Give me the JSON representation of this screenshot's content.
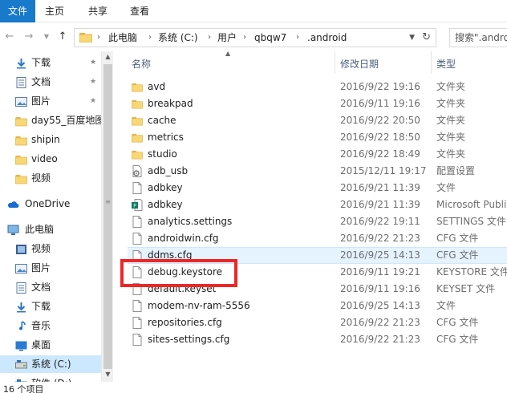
{
  "ribbon": {
    "tabs": [
      "文件",
      "主页",
      "共享",
      "查看"
    ]
  },
  "address": {
    "crumbs": [
      "此电脑",
      "系统 (C:)",
      "用户",
      "qbqw7",
      ".android"
    ],
    "search_placeholder": "搜索\".andro"
  },
  "nav": {
    "items": [
      {
        "label": "下载",
        "icon": "download-arrow-icon",
        "pinned": true
      },
      {
        "label": "文档",
        "icon": "document-icon",
        "pinned": true
      },
      {
        "label": "图片",
        "icon": "picture-icon",
        "pinned": true
      },
      {
        "label": "day55_百度地图",
        "icon": "folder-icon",
        "pinned": false
      },
      {
        "label": "shipin",
        "icon": "folder-icon",
        "pinned": false
      },
      {
        "label": "video",
        "icon": "folder-icon",
        "pinned": false
      },
      {
        "label": "视频",
        "icon": "folder-icon",
        "pinned": false
      },
      {
        "label": "OneDrive",
        "icon": "cloud-icon",
        "pinned": false
      },
      {
        "label": "此电脑",
        "icon": "computer-icon",
        "pinned": false
      },
      {
        "label": "视频",
        "icon": "video-icon",
        "pinned": false
      },
      {
        "label": "图片",
        "icon": "picture-icon",
        "pinned": false
      },
      {
        "label": "文档",
        "icon": "document-icon",
        "pinned": false
      },
      {
        "label": "下载",
        "icon": "download-arrow-icon",
        "pinned": false
      },
      {
        "label": "音乐",
        "icon": "music-note-icon",
        "pinned": false
      },
      {
        "label": "桌面",
        "icon": "desktop-icon",
        "pinned": false
      },
      {
        "label": "系统 (C:)",
        "icon": "drive-icon",
        "pinned": false
      },
      {
        "label": "软件 (D:)",
        "icon": "drive-icon",
        "pinned": false
      }
    ]
  },
  "columns": {
    "name": "名称",
    "date": "修改日期",
    "type": "类型"
  },
  "files": [
    {
      "name": "avd",
      "date": "2016/9/22 19:16",
      "type": "文件夹",
      "icon": "folder-icon"
    },
    {
      "name": "breakpad",
      "date": "2016/9/11 19:16",
      "type": "文件夹",
      "icon": "folder-icon"
    },
    {
      "name": "cache",
      "date": "2016/9/22 20:50",
      "type": "文件夹",
      "icon": "folder-icon"
    },
    {
      "name": "metrics",
      "date": "2016/9/22 18:50",
      "type": "文件夹",
      "icon": "folder-icon"
    },
    {
      "name": "studio",
      "date": "2016/9/22 18:49",
      "type": "文件夹",
      "icon": "folder-icon"
    },
    {
      "name": "adb_usb",
      "date": "2015/12/11 19:17",
      "type": "配置设置",
      "icon": "settings-file-icon"
    },
    {
      "name": "adbkey",
      "date": "2016/9/21 11:39",
      "type": "文件",
      "icon": "file-icon"
    },
    {
      "name": "adbkey",
      "date": "2016/9/21 11:39",
      "type": "Microsoft Publi",
      "icon": "publisher-file-icon"
    },
    {
      "name": "analytics.settings",
      "date": "2016/9/22 19:11",
      "type": "SETTINGS 文件",
      "icon": "file-icon"
    },
    {
      "name": "androidwin.cfg",
      "date": "2016/9/22 21:23",
      "type": "CFG 文件",
      "icon": "file-icon"
    },
    {
      "name": "ddms.cfg",
      "date": "2016/9/25 14:13",
      "type": "CFG 文件",
      "icon": "file-icon"
    },
    {
      "name": "debug.keystore",
      "date": "2016/9/11 19:21",
      "type": "KEYSTORE 文件",
      "icon": "file-icon"
    },
    {
      "name": "default.keyset",
      "date": "2016/9/11 19:16",
      "type": "KEYSET 文件",
      "icon": "file-icon"
    },
    {
      "name": "modem-nv-ram-5556",
      "date": "2016/9/25 14:13",
      "type": "文件",
      "icon": "file-icon"
    },
    {
      "name": "repositories.cfg",
      "date": "2016/9/22 21:23",
      "type": "CFG 文件",
      "icon": "file-icon"
    },
    {
      "name": "sites-settings.cfg",
      "date": "2016/9/22 21:23",
      "type": "CFG 文件",
      "icon": "file-icon"
    }
  ],
  "status": {
    "text": "16 个项目"
  },
  "colors": {
    "file_tab": "#1979ca",
    "highlight": "#ec2727",
    "selected_nav": "#cce8ff"
  }
}
